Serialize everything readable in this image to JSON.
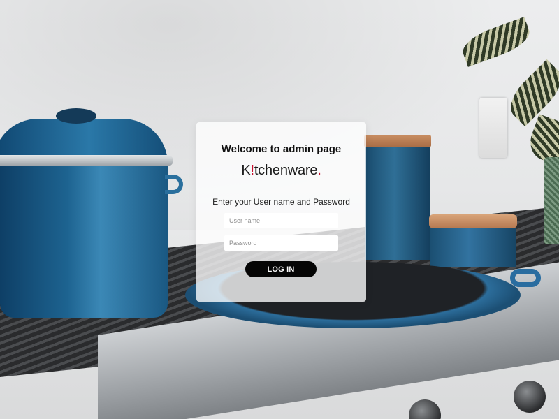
{
  "login": {
    "welcome_title": "Welcome to admin page",
    "brand": {
      "first": "K",
      "mark": "!",
      "rest": "tchenware",
      "dot": "."
    },
    "instruction": "Enter your User name and Password",
    "username_placeholder": "User name",
    "username_value": "",
    "password_placeholder": "Password",
    "password_value": "",
    "login_button": "LOG IN"
  },
  "colors": {
    "brand_accent": "#c8102e",
    "button_bg": "#050505",
    "card_bg": "rgba(255,255,255,0.78)"
  },
  "background": {
    "icon": "kitchen-photo"
  }
}
